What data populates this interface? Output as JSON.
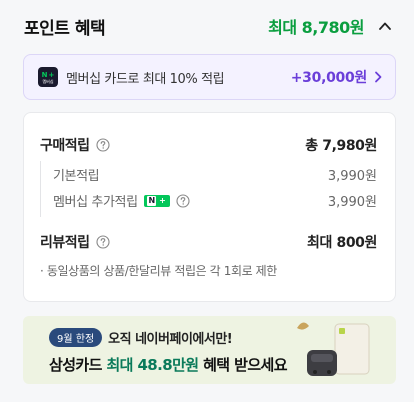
{
  "header": {
    "title": "포인트 혜택",
    "total": "최대 8,780원"
  },
  "membership": {
    "badge_n": "N",
    "badge_plus": "+",
    "badge_sub": "멤버십",
    "text": "멤버십 카드로 최대 10% 적립",
    "amount": "+30,000원"
  },
  "purchase": {
    "label": "구매적립",
    "value": "총 7,980원",
    "basic_label": "기본적립",
    "basic_value": "3,990원",
    "member_label": "멤버십 추가적립",
    "member_value": "3,990원",
    "mini_badge_n": "N",
    "mini_badge_plus": "+"
  },
  "review": {
    "label": "리뷰적립",
    "value": "최대 800원",
    "note": "· 동일상품의 상품/한달리뷰 적립은 각 1회로 제한"
  },
  "banner": {
    "pill": "9월 한정",
    "line1": "오직 네이버페이에서만!",
    "line2_prefix": "삼성카드 ",
    "line2_highlight": "최대 48.8만원",
    "line2_suffix": " 혜택 받으세요"
  },
  "colors": {
    "accent_green": "#0a9e3f",
    "accent_purple": "#6b3fd9",
    "membership_bg": "#f4f2ff",
    "banner_bg": "#eef3e2"
  },
  "icons": [
    "chevron-up-icon",
    "chevron-right-icon",
    "question-circle-icon",
    "npay-membership-icon"
  ]
}
